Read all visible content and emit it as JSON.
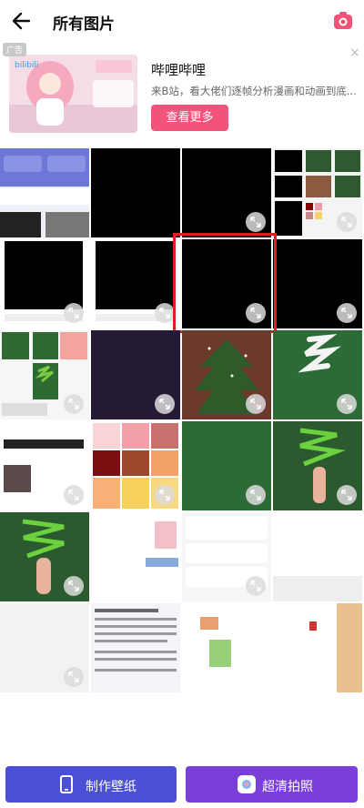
{
  "header": {
    "title": "所有图片"
  },
  "ad": {
    "badge": "广告",
    "title": "哔哩哔哩",
    "description": "来B站，看大佬们逐帧分析漫画和动画到底...",
    "button": "查看更多",
    "close": "×"
  },
  "bottom": {
    "wallpaper_label": "制作壁纸",
    "camera_label": "超清拍照"
  },
  "colors": {
    "accent": "#f2537a",
    "highlight": "#e02020"
  }
}
